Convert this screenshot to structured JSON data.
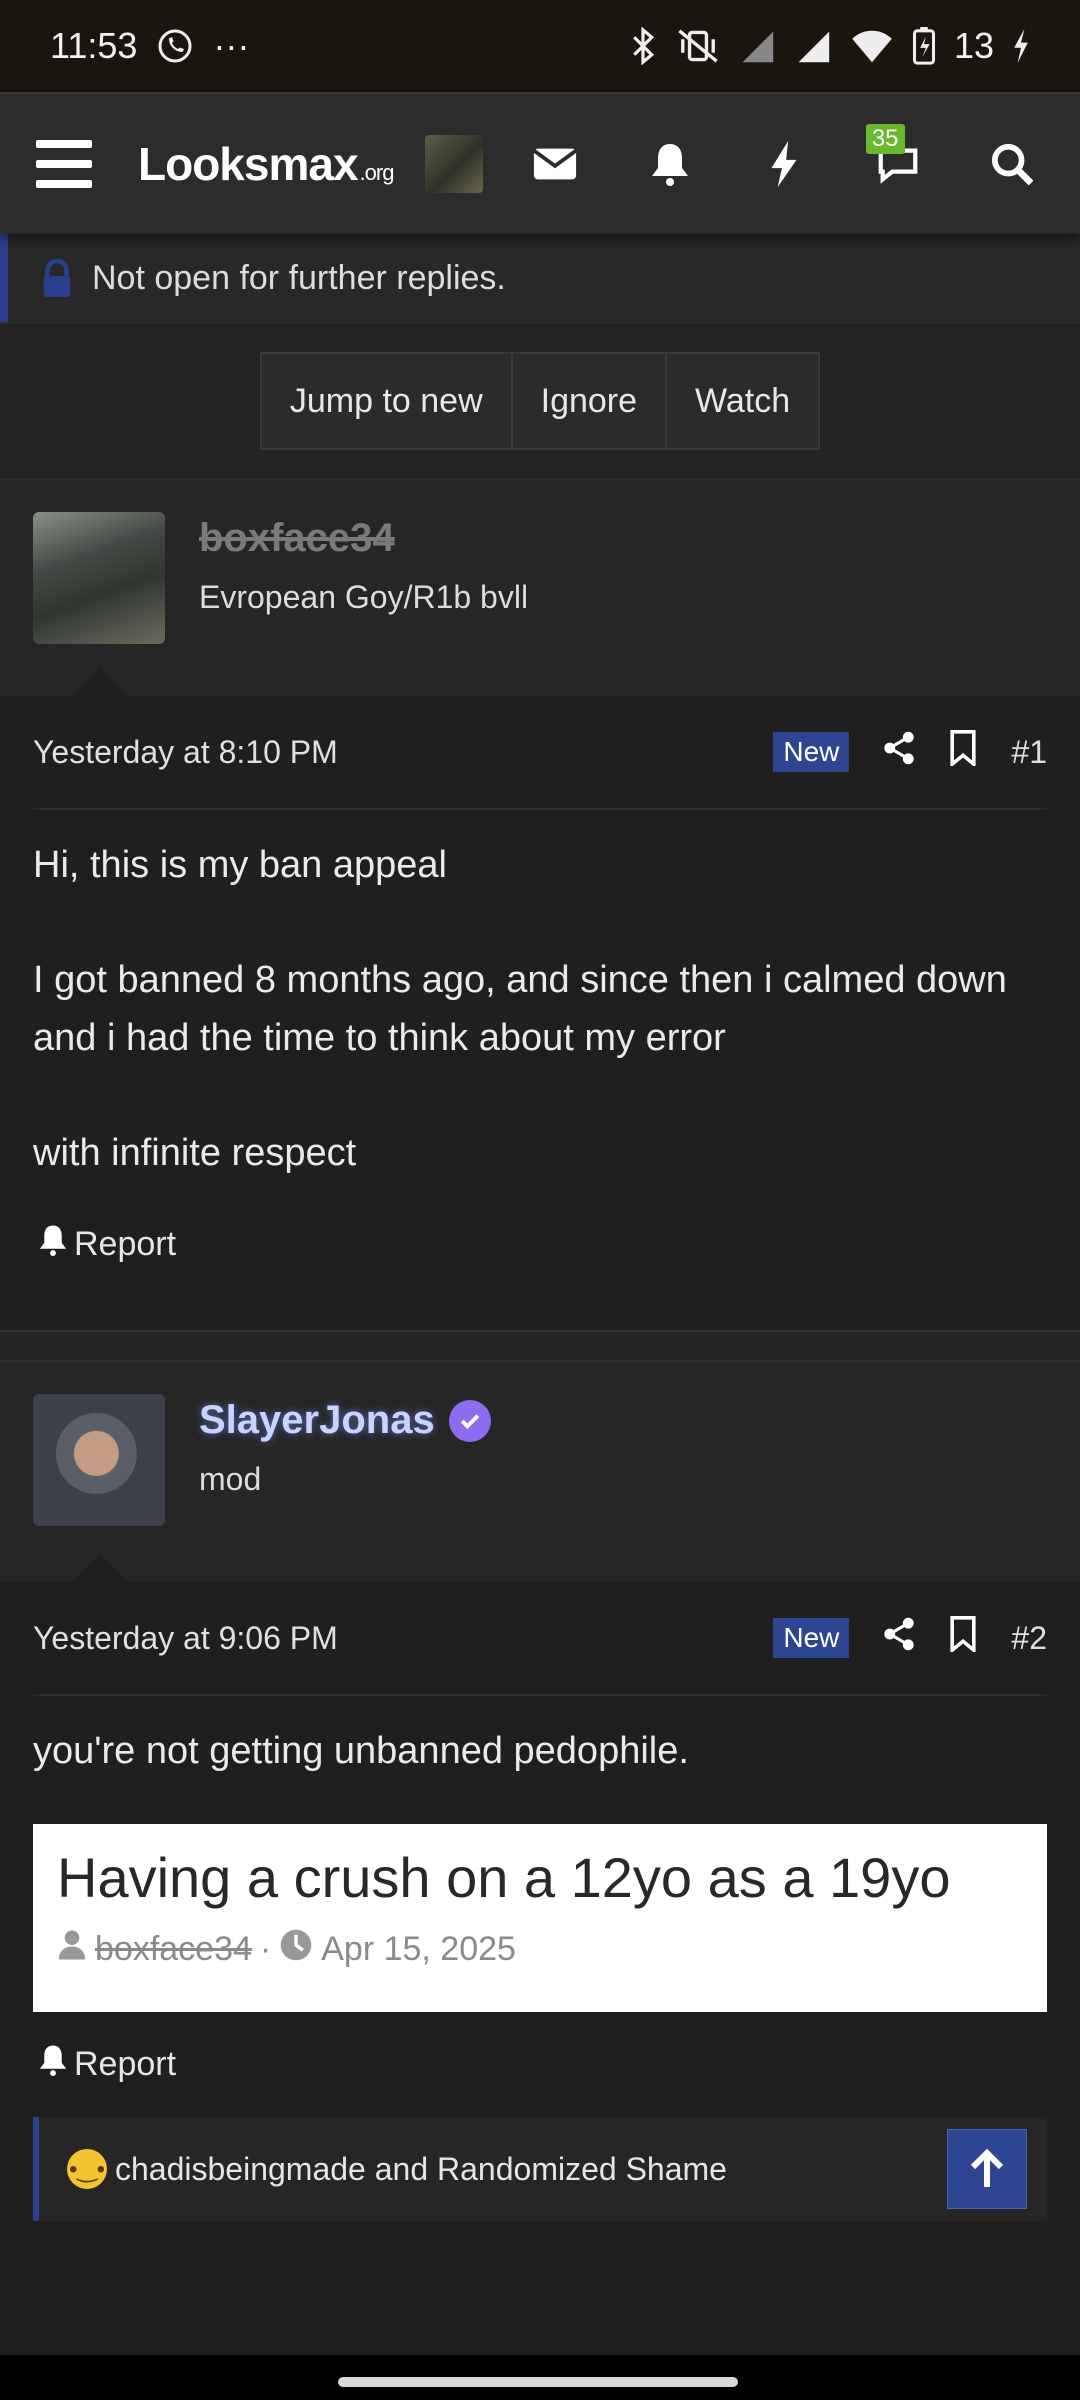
{
  "status_bar": {
    "time": "11:53",
    "more": "···",
    "battery": "13",
    "icons": [
      "call-icon",
      "bluetooth-icon",
      "vibrate-off-icon",
      "signal-icon",
      "wifi-icon",
      "battery-icon",
      "charging-icon"
    ]
  },
  "nav": {
    "logo_main": "Looksmax",
    "logo_suffix": ".org",
    "conversations_badge": "35",
    "icons": [
      "menu-icon",
      "mail-icon",
      "bell-icon",
      "bolt-icon",
      "chat-icon",
      "search-icon"
    ]
  },
  "notice": {
    "text": "Not open for further replies."
  },
  "thread_actions": {
    "jump_label": "Jump to new",
    "ignore_label": "Ignore",
    "watch_label": "Watch"
  },
  "posts": [
    {
      "username": "boxface34",
      "user_title": "Evropean Goy/R1b bvll",
      "timestamp": "Yesterday at 8:10 PM",
      "badge": "New",
      "number": "#1",
      "paragraphs": [
        "Hi, this is my ban appeal",
        "I got banned 8 months ago, and since then i calmed down and i had the time to think about my error",
        "with infinite respect"
      ],
      "report_label": "Report"
    },
    {
      "username": "SlayerJonas",
      "user_title": "mod",
      "timestamp": "Yesterday at 9:06 PM",
      "badge": "New",
      "number": "#2",
      "paragraphs": [
        "you're not getting unbanned pedophile."
      ],
      "embed": {
        "title": "Having a crush on a 12yo as a 19yo",
        "author": "boxface34",
        "separator": "·",
        "date": "Apr 15, 2025"
      },
      "report_label": "Report",
      "reactions": "chadisbeingmade and Randomized Shame"
    }
  ],
  "colors": {
    "accent": "#2e4594",
    "background": "#232323",
    "badge_green": "#6ab82e",
    "verified": "#8e6cf2"
  }
}
